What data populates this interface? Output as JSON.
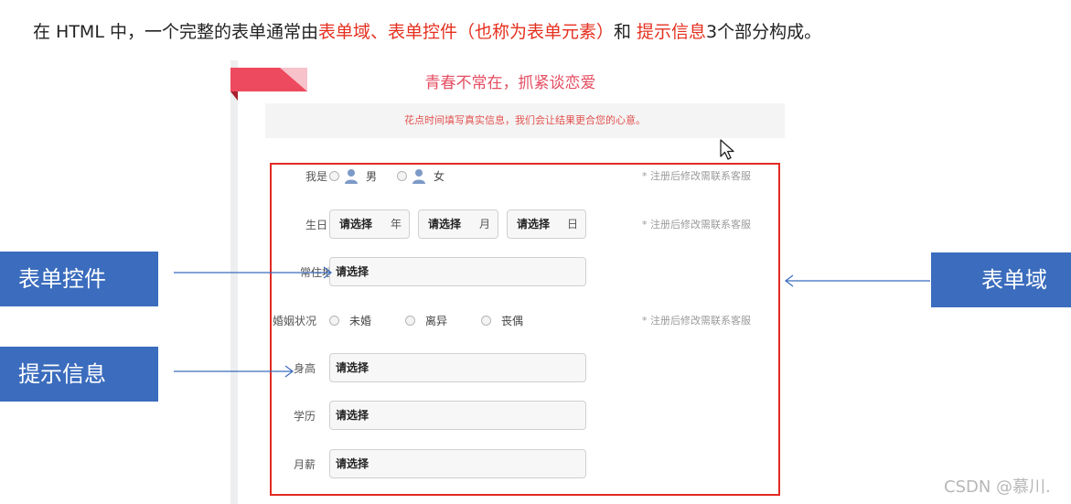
{
  "intro": {
    "prefix": "在 HTML 中，一个完整的表单通常由",
    "part1": "表单域、表单控件（也称为表单元素）",
    "mid": "和 ",
    "part2": "提示信息",
    "suffix": "3个部分构成。"
  },
  "form": {
    "title": "青春不常在，抓紧谈恋爱",
    "tip": "花点时间填写真实信息，我们会让结果更合您的心意。",
    "hint": "* 注册后修改需联系客服",
    "gender": {
      "label": "我是",
      "male": "男",
      "female": "女"
    },
    "birthday": {
      "label": "生日",
      "year": "请选择",
      "year_unit": "年",
      "month": "请选择",
      "month_unit": "月",
      "day": "请选择",
      "day_unit": "日"
    },
    "residence": {
      "label": "常住地",
      "value": "请选择"
    },
    "marital": {
      "label": "婚姻状况",
      "options": [
        "未婚",
        "离异",
        "丧偶"
      ]
    },
    "height": {
      "label": "身高",
      "value": "请选择"
    },
    "education": {
      "label": "学历",
      "value": "请选择"
    },
    "salary": {
      "label": "月薪",
      "value": "请选择"
    }
  },
  "callouts": {
    "form_control": "表单控件",
    "prompt_info": "提示信息",
    "form_field": "表单域"
  },
  "watermark": "CSDN @慕川.",
  "colors": {
    "accent_red": "#e5301f",
    "callout_blue": "#3b6cbd",
    "form_border": "#e22a23",
    "title_pink": "#e44d62"
  }
}
